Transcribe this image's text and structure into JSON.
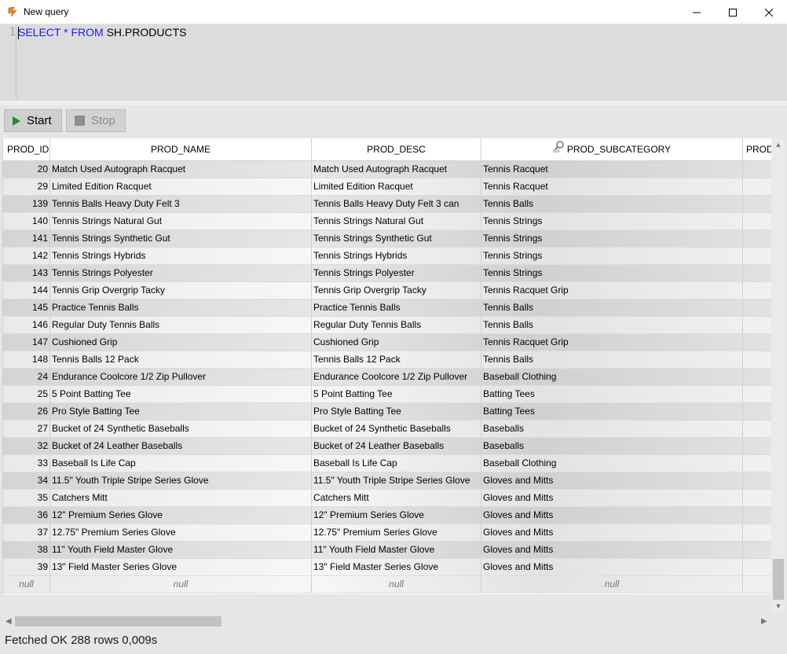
{
  "window": {
    "title": "New query"
  },
  "editor": {
    "line_number": "1",
    "kw_select": "SELECT",
    "star": "*",
    "kw_from": "FROM",
    "table": "SH.PRODUCTS"
  },
  "toolbar": {
    "start_label": "Start",
    "stop_label": "Stop"
  },
  "grid": {
    "columns": [
      "PROD_ID",
      "PROD_NAME",
      "PROD_DESC",
      "PROD_SUBCATEGORY",
      "PROD"
    ],
    "rows": [
      [
        "20",
        "Match Used Autograph Racquet",
        "Match Used Autograph Racquet",
        "Tennis Racquet"
      ],
      [
        "29",
        "Limited Edition Racquet",
        "Limited Edition Racquet",
        "Tennis Racquet"
      ],
      [
        "139",
        "Tennis Balls Heavy Duty Felt 3",
        "Tennis Balls Heavy Duty Felt 3 can",
        "Tennis Balls"
      ],
      [
        "140",
        "Tennis Strings Natural Gut",
        "Tennis Strings Natural Gut",
        "Tennis Strings"
      ],
      [
        "141",
        "Tennis Strings Synthetic Gut",
        "Tennis Strings Synthetic Gut",
        "Tennis Strings"
      ],
      [
        "142",
        "Tennis Strings Hybrids",
        "Tennis Strings Hybrids",
        "Tennis Strings"
      ],
      [
        "143",
        "Tennis Strings Polyester",
        "Tennis Strings Polyester",
        "Tennis Strings"
      ],
      [
        "144",
        "Tennis Grip Overgrip Tacky",
        "Tennis Grip Overgrip Tacky",
        "Tennis Racquet Grip"
      ],
      [
        "145",
        "Practice Tennis Balls",
        "Practice Tennis Balls",
        "Tennis Balls"
      ],
      [
        "146",
        "Regular Duty Tennis Balls",
        "Regular Duty Tennis Balls",
        "Tennis Balls"
      ],
      [
        "147",
        "Cushioned Grip",
        "Cushioned Grip",
        "Tennis Racquet Grip"
      ],
      [
        "148",
        "Tennis Balls 12 Pack",
        "Tennis Balls 12 Pack",
        "Tennis Balls"
      ],
      [
        "24",
        "Endurance Coolcore 1/2 Zip Pullover",
        "Endurance Coolcore 1/2 Zip Pullover",
        "Baseball Clothing"
      ],
      [
        "25",
        "5 Point Batting Tee",
        "5 Point Batting Tee",
        "Batting Tees"
      ],
      [
        "26",
        "Pro Style Batting Tee",
        "Pro Style Batting Tee",
        "Batting Tees"
      ],
      [
        "27",
        "Bucket of 24 Synthetic Baseballs",
        "Bucket of 24 Synthetic Baseballs",
        "Baseballs"
      ],
      [
        "32",
        "Bucket of 24 Leather Baseballs",
        "Bucket of 24 Leather Baseballs",
        "Baseballs"
      ],
      [
        "33",
        "Baseball Is Life Cap",
        "Baseball Is Life Cap",
        "Baseball Clothing"
      ],
      [
        "34",
        "11.5\" Youth Triple Stripe Series Glove",
        "11.5\" Youth Triple Stripe Series Glove",
        "Gloves and Mitts"
      ],
      [
        "35",
        "Catchers Mitt",
        "Catchers Mitt",
        "Gloves and Mitts"
      ],
      [
        "36",
        "12\" Premium Series Glove",
        "12\" Premium Series Glove",
        "Gloves and Mitts"
      ],
      [
        "37",
        "12.75\" Premium Series Glove",
        "12.75\" Premium Series Glove",
        "Gloves and Mitts"
      ],
      [
        "38",
        "11\" Youth Field Master Glove",
        "11\" Youth Field Master Glove",
        "Gloves and Mitts"
      ],
      [
        "39",
        "13\" Field Master Series Glove",
        "13\" Field Master Series Glove",
        "Gloves and Mitts"
      ]
    ],
    "null_label": "null"
  },
  "status": {
    "text": "Fetched OK 288 rows 0,009s"
  }
}
